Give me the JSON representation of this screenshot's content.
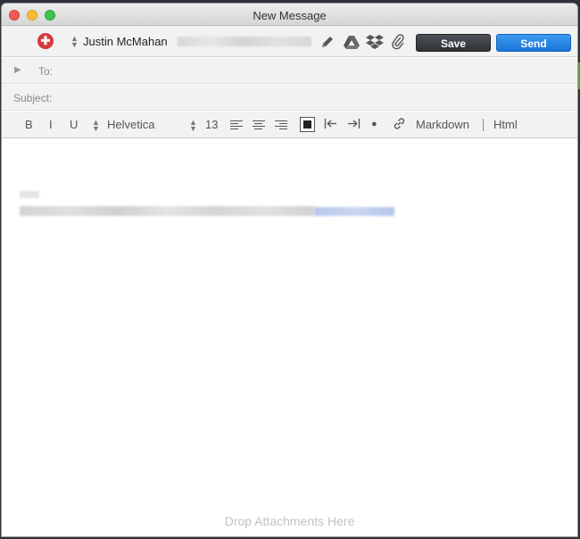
{
  "window": {
    "title": "New Message"
  },
  "from": {
    "name": "Justin McMahan"
  },
  "toolbar": {
    "save_label": "Save",
    "send_label": "Send"
  },
  "fields": {
    "to_label": "To:",
    "to_value": "",
    "subject_label": "Subject:",
    "subject_value": ""
  },
  "format": {
    "bold": "B",
    "italic": "I",
    "underline": "U",
    "font": "Helvetica",
    "size": "13",
    "markdown": "Markdown",
    "html": "Html"
  },
  "compose": {
    "drop_hint": "Drop Attachments Here"
  },
  "colors": {
    "send": "#1a74d8",
    "save": "#2e3236",
    "account": "#d63a3a"
  }
}
